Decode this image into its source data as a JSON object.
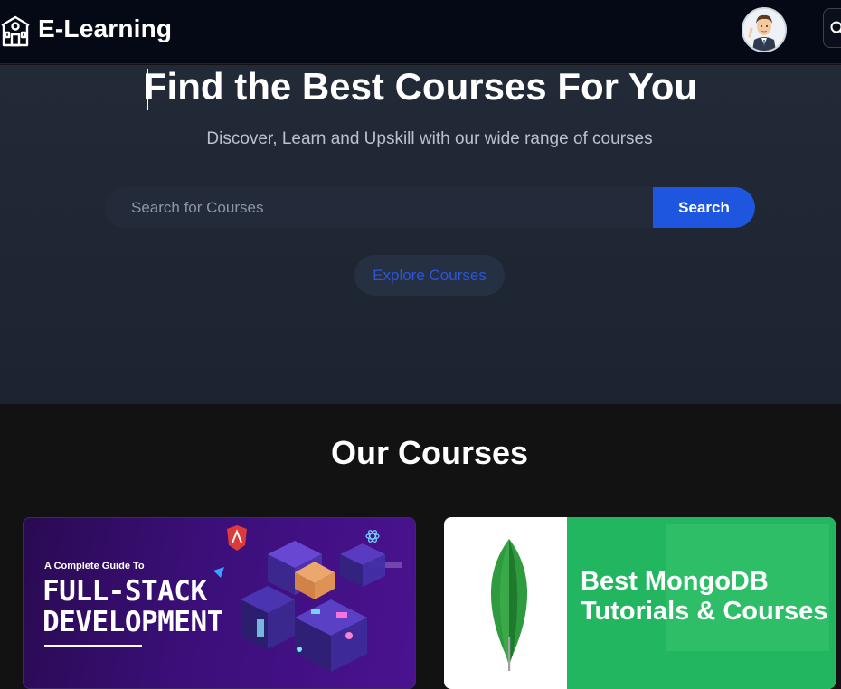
{
  "navbar": {
    "brand": "E-Learning",
    "icons": {
      "brand": "school-icon",
      "edge": "search-icon"
    }
  },
  "hero": {
    "title": "Find the Best Courses For You",
    "subtitle": "Discover, Learn and Upskill with our wide range of courses",
    "search": {
      "placeholder": "Search for Courses",
      "button": "Search"
    },
    "explore": "Explore Courses"
  },
  "courses": {
    "title": "Our Courses",
    "cards": [
      {
        "guide": "A Complete Guide To",
        "line1": "FULL-STACK",
        "line2": "DEVELOPMENT"
      },
      {
        "line1": "Best MongoDB",
        "line2": "Tutorials & Courses"
      }
    ]
  },
  "colors": {
    "accent": "#1f56e0",
    "nav_bg": "#050915",
    "hero_bg": "#222a38",
    "section_bg": "#121212",
    "mongodb_green": "#22b660"
  }
}
